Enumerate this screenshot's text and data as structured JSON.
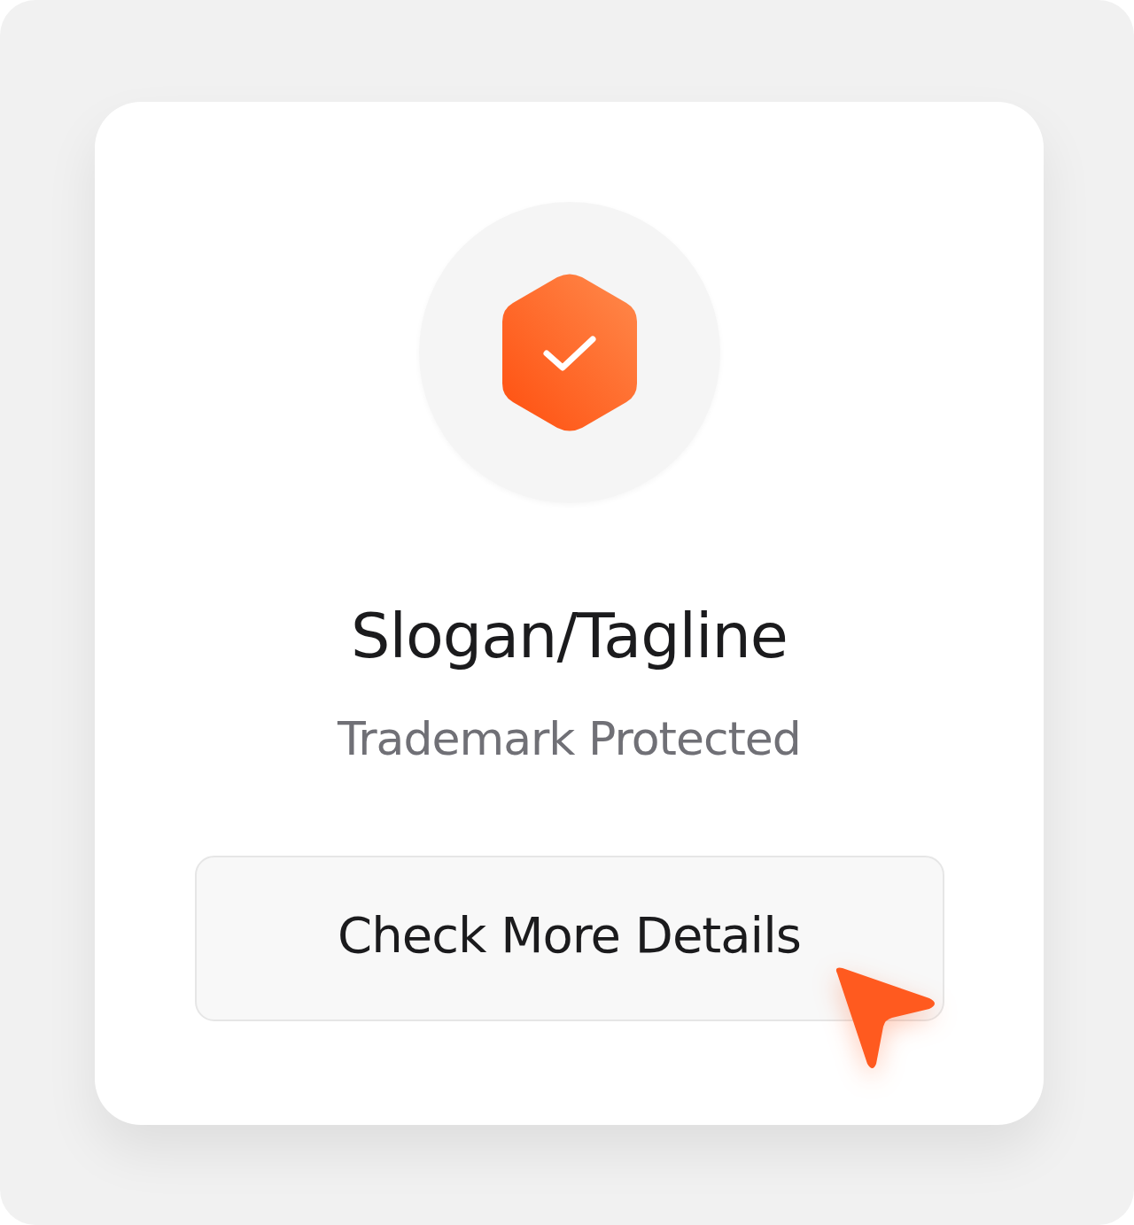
{
  "card": {
    "title": "Slogan/Tagline",
    "subtitle": "Trademark Protected",
    "button": {
      "label": "Check More Details"
    }
  }
}
